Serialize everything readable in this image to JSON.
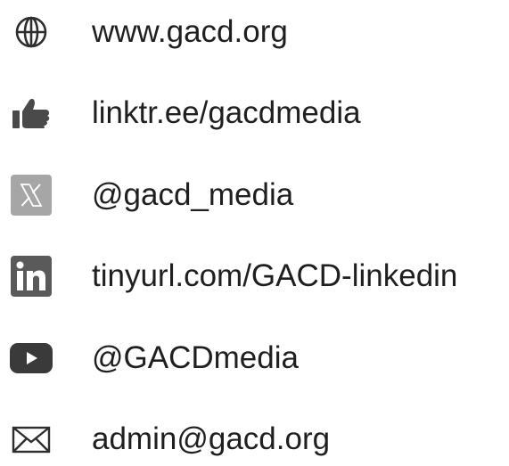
{
  "contacts": [
    {
      "icon": "globe-icon",
      "text": "www.gacd.org"
    },
    {
      "icon": "thumbs-up-icon",
      "text": "linktr.ee/gacdmedia"
    },
    {
      "icon": "x-logo-icon",
      "text": "@gacd_media"
    },
    {
      "icon": "linkedin-icon",
      "text": "tinyurl.com/GACD-linkedin"
    },
    {
      "icon": "youtube-icon",
      "text": "@GACDmedia"
    },
    {
      "icon": "mail-icon",
      "text": "admin@gacd.org"
    }
  ],
  "colors": {
    "text": "#1f1f1f",
    "icon_dark": "#3a3a3a",
    "icon_medium": "#5a5a5a",
    "icon_light": "#a6a6a6",
    "icon_glyph": "#ffffff"
  }
}
